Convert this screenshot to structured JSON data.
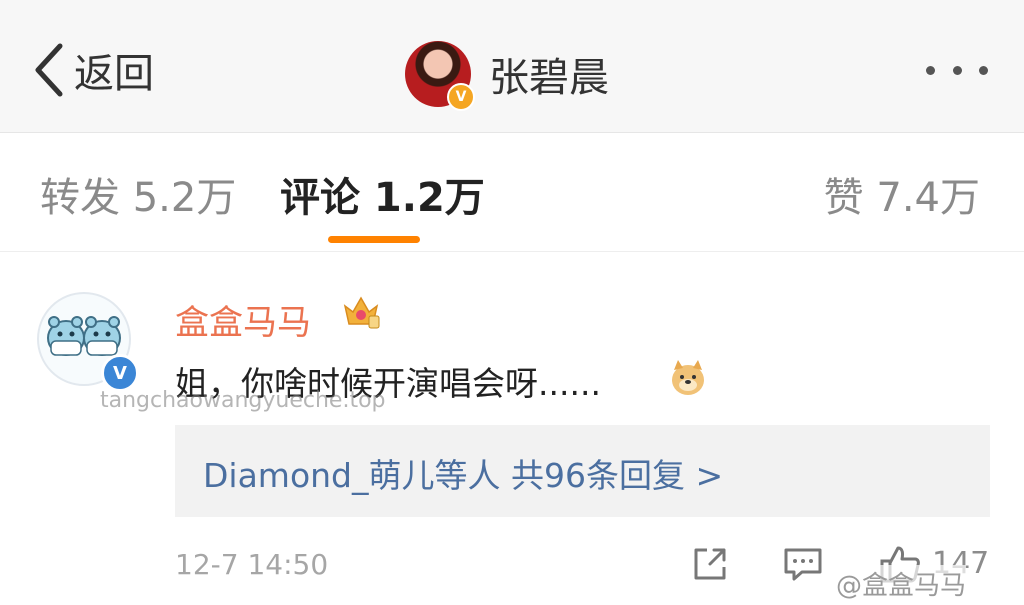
{
  "navbar": {
    "back_label": "返回",
    "profile_name": "张碧晨",
    "avatar_badge": "V"
  },
  "tabs": {
    "repost": "转发 5.2万",
    "comments": "评论 1.2万",
    "likes": "赞 7.4万",
    "accent_color": "#ff8200"
  },
  "comment": {
    "user": "盒盒马马",
    "badge": "V",
    "text": "姐，你啥时候开演唱会呀......",
    "watermark": "tangchaowangyueche.top",
    "reply_summary": "Diamond_萌儿等人  共96条回复 >",
    "time": "12-7 14:50",
    "like_count": "147",
    "corner_watermark": "@盒盒马马"
  }
}
